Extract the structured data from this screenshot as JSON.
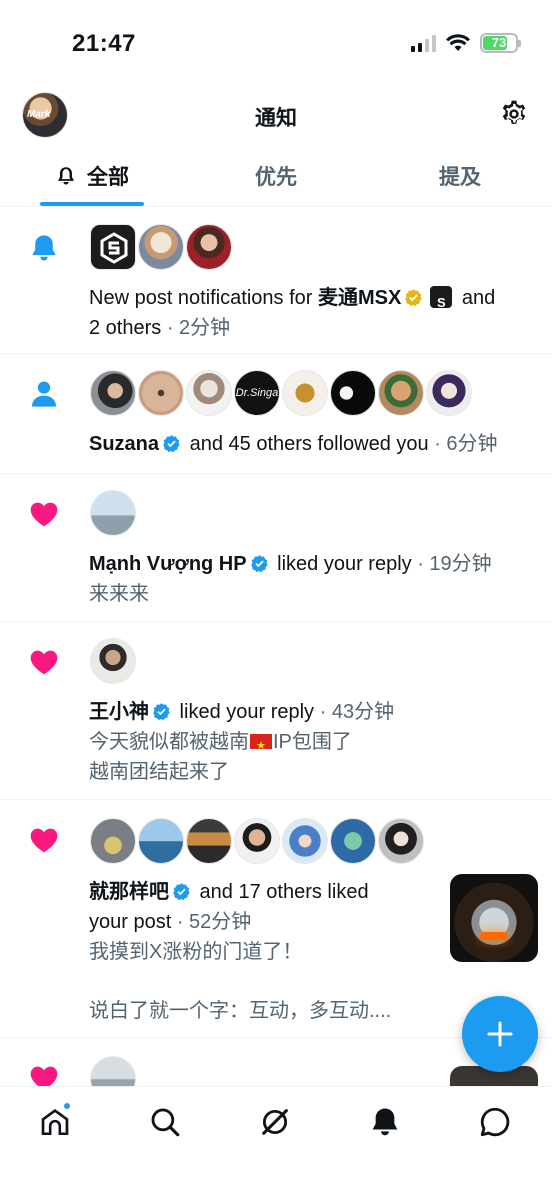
{
  "status_bar": {
    "time": "21:47",
    "battery": "73"
  },
  "header": {
    "title": "通知",
    "avatar_text": "Mark"
  },
  "tabs": [
    {
      "label": "全部",
      "active": true
    },
    {
      "label": "优先",
      "active": false
    },
    {
      "label": "提及",
      "active": false
    }
  ],
  "notifications": [
    {
      "type": "new-post",
      "line1_prefix": "New post notifications for ",
      "user": "麦通MSX",
      "line1_suffix": " and",
      "line2": "2 others",
      "time": " · 2分钟"
    },
    {
      "type": "follow",
      "user": "Suzana",
      "action": " and 45 others followed you",
      "time": " · 6分钟"
    },
    {
      "type": "like",
      "user": "Mạnh Vượng HP",
      "action": " liked your reply",
      "time": " · 19分钟",
      "body": "来来来"
    },
    {
      "type": "like",
      "user": "王小神",
      "action": " liked your reply",
      "time": " · 43分钟",
      "body_part1": "今天貌似都被越南",
      "body_part2": "IP包围了",
      "body_line2": "越南团结起来了"
    },
    {
      "type": "like",
      "user": "就那样吧",
      "action": " and 17 others liked",
      "action_line2": "your post",
      "time": " · 52分钟",
      "body_line1": "我摸到X涨粉的门道了！",
      "body_line2": "说白了就一个字：互动，多互动...."
    }
  ],
  "icons": {
    "bell": "bell-icon",
    "person": "person-icon",
    "heart": "heart-icon",
    "verified": "verified-badge-icon",
    "gear": "gear-icon",
    "compose": "plus-icon"
  },
  "colors": {
    "accent": "#1d9bf0",
    "heart": "#f91880",
    "gold_badge": "#e2b719",
    "muted": "#536471"
  }
}
